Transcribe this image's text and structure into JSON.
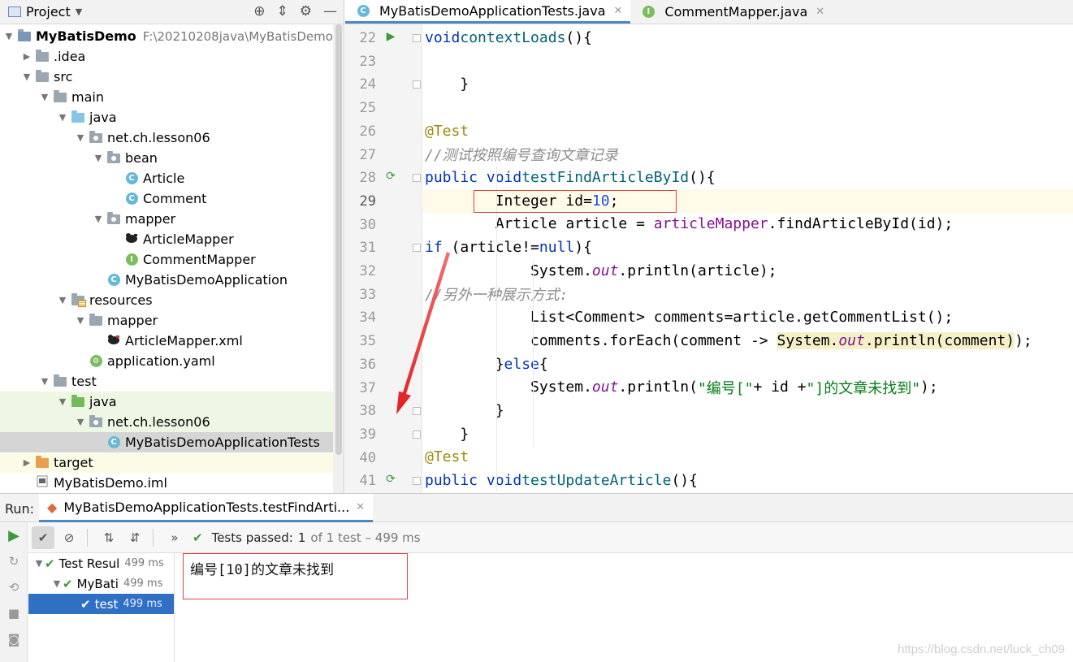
{
  "project_panel": {
    "title": "Project",
    "tree": [
      {
        "label": "MyBatisDemo",
        "path": "F:\\20210208java\\MyBatisDemo",
        "icon": "module-folder-icon",
        "level": 0,
        "expanded": true
      },
      {
        "label": ".idea",
        "icon": "folder-icon",
        "level": 1,
        "expanded": false
      },
      {
        "label": "src",
        "icon": "folder-icon",
        "level": 1,
        "expanded": true
      },
      {
        "label": "main",
        "icon": "folder-icon",
        "level": 2,
        "expanded": true
      },
      {
        "label": "java",
        "icon": "source-folder-icon",
        "level": 3,
        "expanded": true
      },
      {
        "label": "net.ch.lesson06",
        "icon": "package-icon",
        "level": 4,
        "expanded": true
      },
      {
        "label": "bean",
        "icon": "package-icon",
        "level": 5,
        "expanded": true
      },
      {
        "label": "Article",
        "icon": "class-icon",
        "level": 6
      },
      {
        "label": "Comment",
        "icon": "class-icon",
        "level": 6
      },
      {
        "label": "mapper",
        "icon": "package-icon",
        "level": 5,
        "expanded": true
      },
      {
        "label": "ArticleMapper",
        "icon": "mybatis-mapper-icon",
        "level": 6
      },
      {
        "label": "CommentMapper",
        "icon": "interface-icon",
        "level": 6
      },
      {
        "label": "MyBatisDemoApplication",
        "icon": "spring-class-icon",
        "level": 5
      },
      {
        "label": "resources",
        "icon": "resources-folder-icon",
        "level": 3,
        "expanded": true
      },
      {
        "label": "mapper",
        "icon": "folder-icon",
        "level": 4,
        "expanded": true
      },
      {
        "label": "ArticleMapper.xml",
        "icon": "mybatis-xml-icon",
        "level": 5
      },
      {
        "label": "application.yaml",
        "icon": "spring-config-icon",
        "level": 4
      },
      {
        "label": "test",
        "icon": "folder-icon",
        "level": 2,
        "expanded": true
      },
      {
        "label": "java",
        "icon": "test-folder-icon",
        "level": 3,
        "expanded": true
      },
      {
        "label": "net.ch.lesson06",
        "icon": "package-icon",
        "level": 4,
        "expanded": true
      },
      {
        "label": "MyBatisDemoApplicationTests",
        "icon": "spring-class-icon",
        "level": 5
      },
      {
        "label": "target",
        "icon": "excluded-folder-icon",
        "level": 1,
        "expanded": false
      },
      {
        "label": "MyBatisDemo.iml",
        "icon": "iml-file-icon",
        "level": 1
      }
    ]
  },
  "editor": {
    "tabs": [
      {
        "label": "MyBatisDemoApplicationTests.java",
        "icon": "spring-class-icon",
        "active": true
      },
      {
        "label": "CommentMapper.java",
        "icon": "interface-icon",
        "active": false
      }
    ],
    "lines": [
      {
        "n": "22",
        "gutter": "run",
        "fold": true,
        "html": "    <span class=\"kw\">void</span> <span class=\"fn\">contextLoads</span>(){"
      },
      {
        "n": "23",
        "html": ""
      },
      {
        "n": "24",
        "fold": true,
        "html": "    }"
      },
      {
        "n": "25",
        "html": ""
      },
      {
        "n": "26",
        "html": "    <span class=\"ann\">@Test</span>"
      },
      {
        "n": "27",
        "html": "    <span class=\"cmt\">//测试按照编号查询文章记录</span>"
      },
      {
        "n": "28",
        "gutter": "rerun",
        "fold": true,
        "html": "    <span class=\"kw\">public void</span> <span class=\"fn\">testFindArticleById</span>(){"
      },
      {
        "n": "29",
        "current": true,
        "html": "        Integer id=<span class=\"num\">10</span>;"
      },
      {
        "n": "30",
        "html": "        Article article = <span class=\"fld\">articleMapper</span>.findArticleById(id);"
      },
      {
        "n": "31",
        "fold": true,
        "html": "        <span class=\"kw\">if</span> (article!=<span class=\"kw\">null</span>){"
      },
      {
        "n": "32",
        "html": "            System.<span class=\"sfld\">out</span>.println(article);"
      },
      {
        "n": "33",
        "html": "            <span class=\"cmt\">//另外一种展示方式:</span>"
      },
      {
        "n": "34",
        "html": "            List&lt;Comment&gt; comments=article.getCommentList();"
      },
      {
        "n": "35",
        "html": "            comments.forEach(comment -&gt; <span class=\"hl-box\">System.<span class=\"sfld\">out</span>.println(comment)</span>);"
      },
      {
        "n": "36",
        "html": "        }<span class=\"kw\">else</span>{"
      },
      {
        "n": "37",
        "html": "            System.<span class=\"sfld\">out</span>.println(<span class=\"str\">\"编号[\"</span>+ id +<span class=\"str\">\"]的文章未找到\"</span>);"
      },
      {
        "n": "38",
        "fold": true,
        "html": "        }"
      },
      {
        "n": "39",
        "fold": true,
        "html": "    }"
      },
      {
        "n": "40",
        "html": "    <span class=\"ann\">@Test</span>"
      },
      {
        "n": "41",
        "gutter": "rerun",
        "fold": true,
        "html": "    <span class=\"kw\">public void</span> <span class=\"fn\">testUpdateArticle</span>(){"
      }
    ]
  },
  "run_panel": {
    "label": "Run:",
    "tab_label": "MyBatisDemoApplicationTests.testFindArti...",
    "status_prefix": "Tests passed:",
    "status_count": "1",
    "status_suffix": "of 1 test – 499 ms",
    "test_tree": [
      {
        "label": "Test Resul",
        "ms": "499 ms",
        "level": 0,
        "expanded": true
      },
      {
        "label": "MyBati",
        "ms": "499 ms",
        "level": 1,
        "expanded": true
      },
      {
        "label": "test",
        "ms": "499 ms",
        "level": 2,
        "selected": true
      }
    ],
    "console_output": "编号[10]的文章未找到"
  },
  "watermark": "https://blog.csdn.net/luck_ch09"
}
